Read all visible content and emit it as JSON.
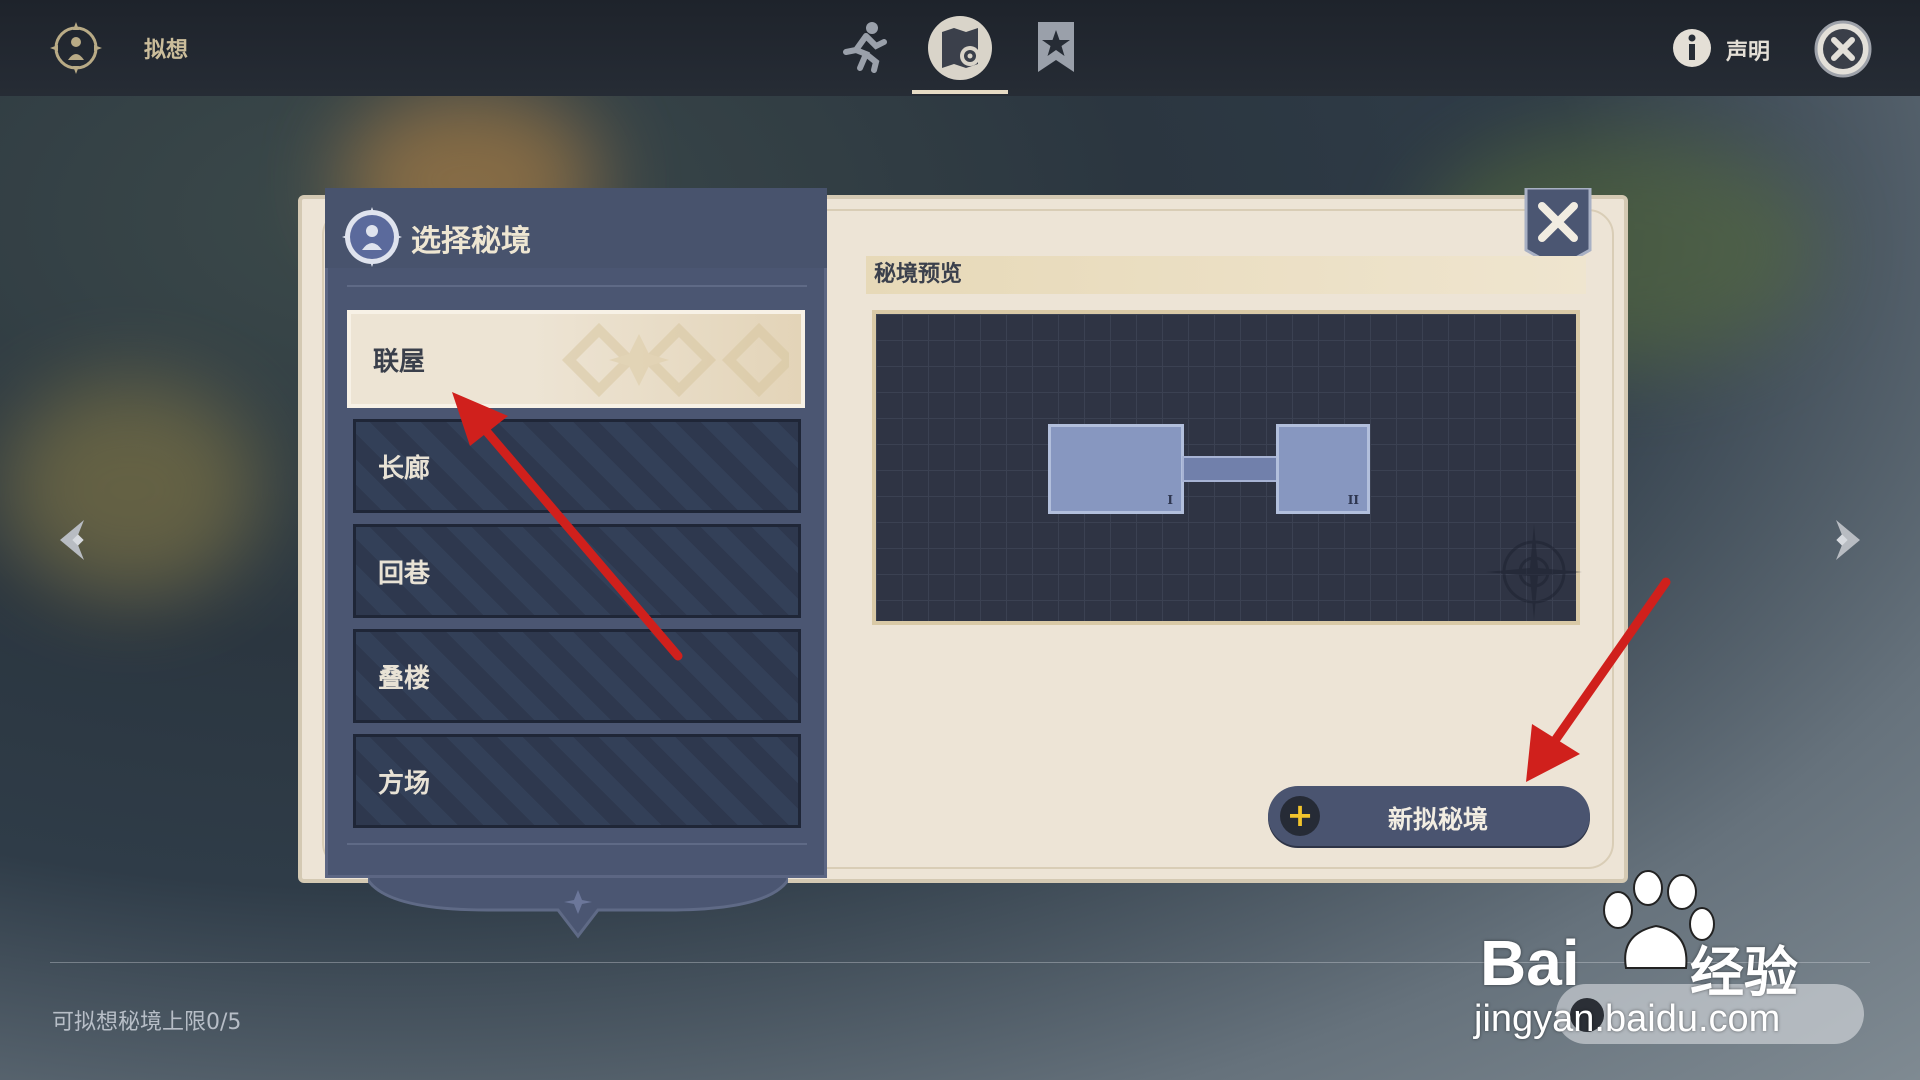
{
  "header": {
    "title": "拟想",
    "tabs": [
      {
        "icon": "running-figure-icon"
      },
      {
        "icon": "map-gear-icon",
        "active": true
      },
      {
        "icon": "bookmark-star-icon"
      }
    ],
    "info_label": "声明"
  },
  "panel": {
    "title": "选择秘境",
    "domains": [
      "联屋",
      "长廊",
      "回巷",
      "叠楼",
      "方场"
    ],
    "selected_index": 0,
    "preview_label": "秘境预览",
    "preview_rooms": [
      "I",
      "II"
    ],
    "new_button_label": "新拟秘境"
  },
  "footer": {
    "limit_text": "可拟想秘境上限0/5"
  },
  "watermark": {
    "brand": "Bai",
    "suffix": "经验",
    "url": "jingyan.baidu.com"
  },
  "colors": {
    "accent_gold": "#cbbd9b",
    "panel_blue": "#4b5672",
    "panel_cream": "#ede4d6",
    "plus_yellow": "#f2c42c",
    "annotation_red": "#d0201c"
  }
}
